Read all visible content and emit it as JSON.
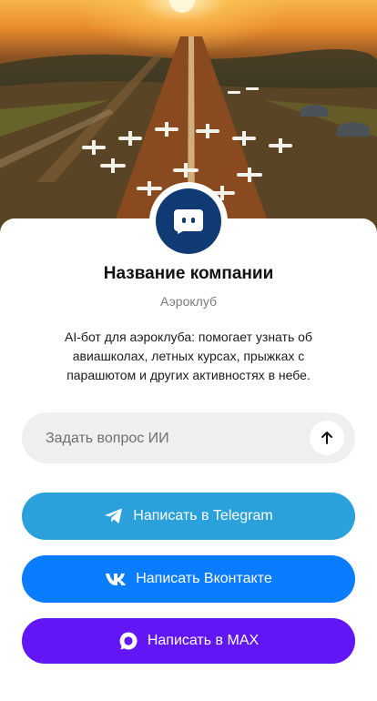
{
  "colors": {
    "telegram": "#2aa1db",
    "vkontakte": "#0a7cff",
    "max": "#6215f5",
    "avatar": "#0f3a74"
  },
  "hero": {
    "icon": "airfield-sunset-photo"
  },
  "profile": {
    "avatar_icon": "chat-bot-icon",
    "name": "Название компании",
    "type": "Аэроклуб",
    "description": "AI-бот для аэроклуба: помогает узнать об авиашколах, летных курсах, прыжках с парашютом и других активностях в небе."
  },
  "ask": {
    "placeholder": "Задать вопрос ИИ",
    "send_icon": "arrow-up-icon"
  },
  "buttons": {
    "telegram": {
      "label": "Написать в Telegram",
      "icon": "telegram-icon"
    },
    "vkontakte": {
      "label": "Написать Вконтакте",
      "icon": "vk-icon"
    },
    "max": {
      "label": "Написать в MAX",
      "icon": "max-icon"
    }
  }
}
